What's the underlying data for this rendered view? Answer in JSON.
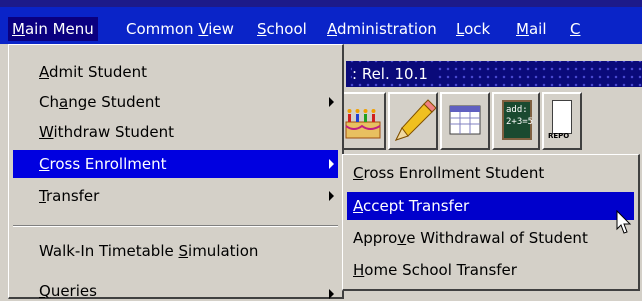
{
  "menubar": {
    "items": [
      {
        "label": "Main Menu",
        "accel": "M",
        "rest": "ain Menu"
      },
      {
        "label": "Common View",
        "pre": "Common ",
        "accel": "V",
        "rest": "iew"
      },
      {
        "label": "School",
        "accel": "S",
        "rest": "chool"
      },
      {
        "label": "Administration",
        "accel": "A",
        "rest": "dministration"
      },
      {
        "label": "Lock",
        "accel": "L",
        "rest": "ock"
      },
      {
        "label": "Mail",
        "accel": "M",
        "rest": "ail"
      },
      {
        "label": "C",
        "accel": "C",
        "rest": ""
      }
    ]
  },
  "banner": {
    "text": ": Rel. 10.1"
  },
  "toolbar": {
    "calc_text_1": "add:",
    "calc_text_2": "2+3=5",
    "report_text": "REPO"
  },
  "main_menu": {
    "items": [
      {
        "pre": "",
        "accel": "A",
        "rest": "dmit Student",
        "submenu": false,
        "selected": false
      },
      {
        "pre": "Ch",
        "accel": "a",
        "rest": "nge Student",
        "submenu": true,
        "selected": false
      },
      {
        "pre": "",
        "accel": "W",
        "rest": "ithdraw Student",
        "submenu": false,
        "selected": false
      },
      {
        "pre": "",
        "accel": "C",
        "rest": "ross Enrollment",
        "submenu": true,
        "selected": true
      },
      {
        "pre": "",
        "accel": "T",
        "rest": "ransfer",
        "submenu": true,
        "selected": false
      },
      {
        "pre": "Walk-In Timetable ",
        "accel": "S",
        "rest": "imulation",
        "submenu": false,
        "selected": false
      },
      {
        "pre": "",
        "accel": "Q",
        "rest": "ueries",
        "submenu": true,
        "selected": false
      }
    ]
  },
  "cross_enrollment_menu": {
    "items": [
      {
        "pre": "",
        "accel": "C",
        "rest": "ross Enrollment Student",
        "selected": false
      },
      {
        "pre": "",
        "accel": "A",
        "rest": "ccept Transfer",
        "selected": true
      },
      {
        "pre": "Appro",
        "accel": "v",
        "rest": "e Withdrawal of Student",
        "selected": false
      },
      {
        "pre": "",
        "accel": "H",
        "rest": "ome School Transfer",
        "selected": false
      }
    ]
  }
}
